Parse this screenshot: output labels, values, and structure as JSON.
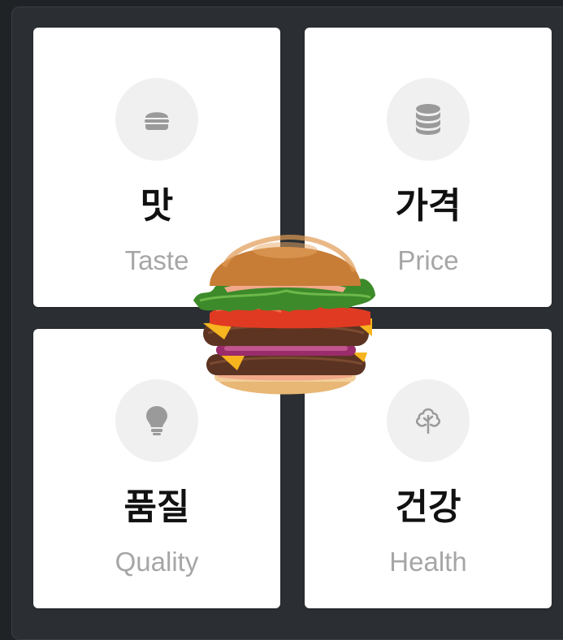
{
  "cards": [
    {
      "title": "맛",
      "subtitle": "Taste",
      "icon": "burger-icon"
    },
    {
      "title": "가격",
      "subtitle": "Price",
      "icon": "coins-icon"
    },
    {
      "title": "품질",
      "subtitle": "Quality",
      "icon": "lightbulb-icon"
    },
    {
      "title": "건강",
      "subtitle": "Health",
      "icon": "tree-icon"
    }
  ],
  "colors": {
    "background": "#2b2f33",
    "card": "#ffffff",
    "icon_circle": "#f0f0f0",
    "icon": "#9a9a9a",
    "title": "#111111",
    "subtitle": "#a6a6a6"
  }
}
